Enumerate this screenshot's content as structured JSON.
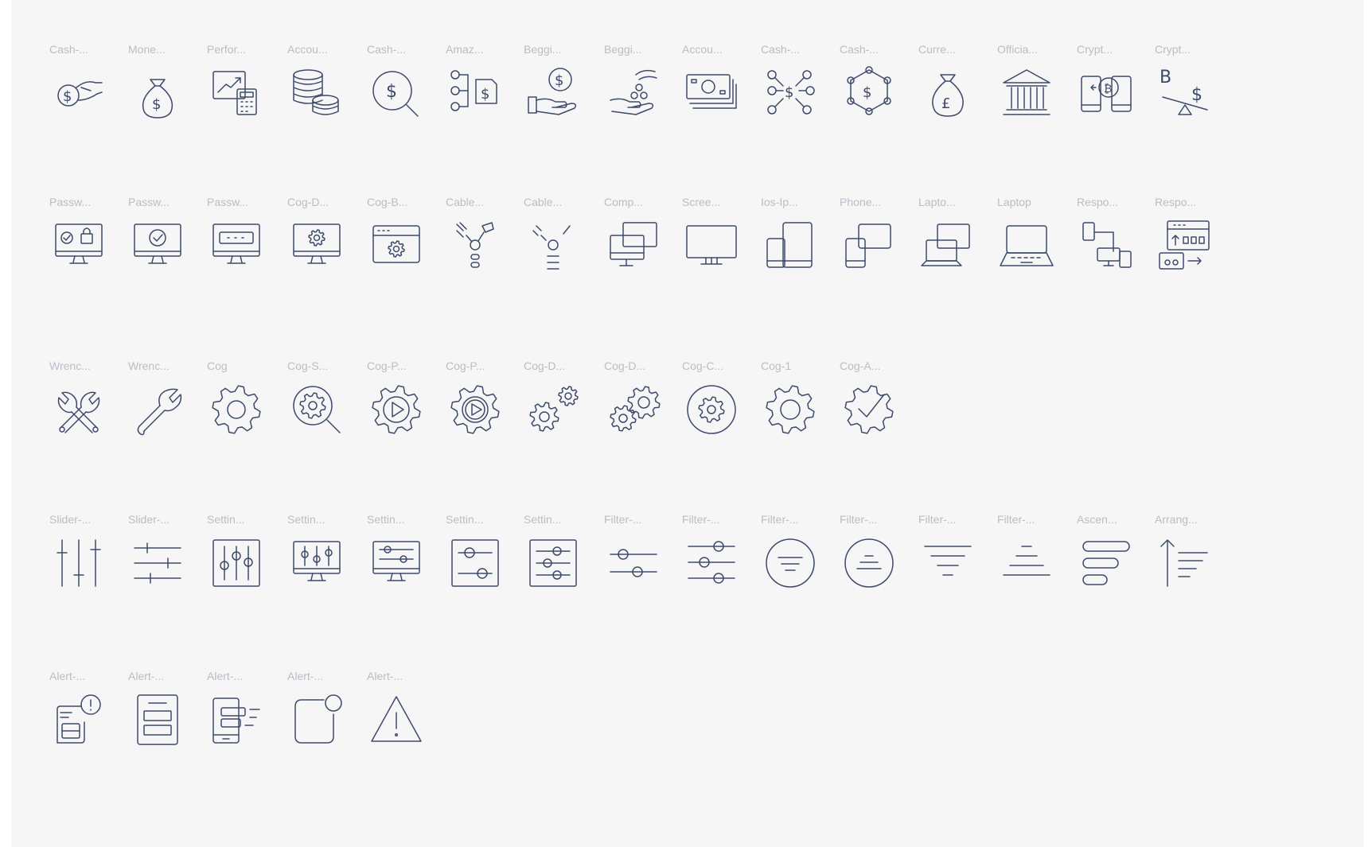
{
  "rows": [
    [
      {
        "label": "Cash-...",
        "icon": "cash-hand-icon"
      },
      {
        "label": "Mone...",
        "icon": "money-bag-dollar-icon"
      },
      {
        "label": "Perfor...",
        "icon": "performance-calculator-icon"
      },
      {
        "label": "Accou...",
        "icon": "coin-stack-icon"
      },
      {
        "label": "Cash-...",
        "icon": "cash-search-icon"
      },
      {
        "label": "Amaz...",
        "icon": "amazon-payment-flow-icon"
      },
      {
        "label": "Beggi...",
        "icon": "begging-hand-coin-icon"
      },
      {
        "label": "Beggi...",
        "icon": "begging-hand-coins-drop-icon"
      },
      {
        "label": "Accou...",
        "icon": "bank-notes-icon"
      },
      {
        "label": "Cash-...",
        "icon": "cash-network-icon"
      },
      {
        "label": "Cash-...",
        "icon": "cash-hexagon-icon"
      },
      {
        "label": "Curre...",
        "icon": "currency-pound-bag-icon"
      },
      {
        "label": "Officia...",
        "icon": "bank-building-icon"
      },
      {
        "label": "Crypt...",
        "icon": "crypto-exchange-devices-icon"
      },
      {
        "label": "Crypt...",
        "icon": "crypto-balance-scale-icon"
      }
    ],
    [
      {
        "label": "Passw...",
        "icon": "password-monitor-lock-icon"
      },
      {
        "label": "Passw...",
        "icon": "password-monitor-check-icon"
      },
      {
        "label": "Passw...",
        "icon": "password-monitor-field-icon"
      },
      {
        "label": "Cog-D...",
        "icon": "cog-desktop-icon"
      },
      {
        "label": "Cog-B...",
        "icon": "cog-browser-icon"
      },
      {
        "label": "Cable...",
        "icon": "cable-plug-icon"
      },
      {
        "label": "Cable...",
        "icon": "cable-disconnect-icon"
      },
      {
        "label": "Comp...",
        "icon": "computer-multiple-icon"
      },
      {
        "label": "Scree...",
        "icon": "screen-monitor-icon"
      },
      {
        "label": "Ios-Ip...",
        "icon": "ios-ipad-phone-icon"
      },
      {
        "label": "Phone...",
        "icon": "phone-screens-icon"
      },
      {
        "label": "Lapto...",
        "icon": "laptop-screens-icon"
      },
      {
        "label": "Laptop",
        "icon": "laptop-icon"
      },
      {
        "label": "Respo...",
        "icon": "responsive-devices-icon"
      },
      {
        "label": "Respo...",
        "icon": "responsive-design-icon"
      }
    ],
    [
      {
        "label": "Wrenc...",
        "icon": "wrench-cross-icon"
      },
      {
        "label": "Wrenc...",
        "icon": "wrench-icon"
      },
      {
        "label": "Cog",
        "icon": "cog-icon"
      },
      {
        "label": "Cog-S...",
        "icon": "cog-search-icon"
      },
      {
        "label": "Cog-P...",
        "icon": "cog-play-icon"
      },
      {
        "label": "Cog-P...",
        "icon": "cog-play-bold-icon"
      },
      {
        "label": "Cog-D...",
        "icon": "cog-double-icon"
      },
      {
        "label": "Cog-D...",
        "icon": "cog-double-alt-icon"
      },
      {
        "label": "Cog-C...",
        "icon": "cog-circle-icon"
      },
      {
        "label": "Cog-1",
        "icon": "cog-1-icon"
      },
      {
        "label": "Cog-A...",
        "icon": "cog-approved-icon"
      }
    ],
    [
      {
        "label": "Slider-...",
        "icon": "slider-vertical-icon"
      },
      {
        "label": "Slider-...",
        "icon": "slider-horizontal-icon"
      },
      {
        "label": "Settin...",
        "icon": "settings-sliders-panel-icon"
      },
      {
        "label": "Settin...",
        "icon": "settings-sliders-desktop-icon"
      },
      {
        "label": "Settin...",
        "icon": "settings-slider-desktop-horizontal-icon"
      },
      {
        "label": "Settin...",
        "icon": "settings-slider-box-icon"
      },
      {
        "label": "Settin...",
        "icon": "settings-slider-box-triple-icon"
      },
      {
        "label": "Filter-...",
        "icon": "filter-slider-two-icon"
      },
      {
        "label": "Filter-...",
        "icon": "filter-slider-three-icon"
      },
      {
        "label": "Filter-...",
        "icon": "filter-circle-icon"
      },
      {
        "label": "Filter-...",
        "icon": "filter-circle-alt-icon"
      },
      {
        "label": "Filter-...",
        "icon": "filter-lines-icon"
      },
      {
        "label": "Filter-...",
        "icon": "filter-lines-alt-icon"
      },
      {
        "label": "Ascen...",
        "icon": "ascending-bars-icon"
      },
      {
        "label": "Arrang...",
        "icon": "arrange-ascending-icon"
      }
    ],
    [
      {
        "label": "Alert-...",
        "icon": "alert-document-icon"
      },
      {
        "label": "Alert-...",
        "icon": "alert-panel-icon"
      },
      {
        "label": "Alert-...",
        "icon": "alert-phone-icon"
      },
      {
        "label": "Alert-...",
        "icon": "alert-badge-icon"
      },
      {
        "label": "Alert-...",
        "icon": "alert-triangle-icon"
      }
    ]
  ]
}
